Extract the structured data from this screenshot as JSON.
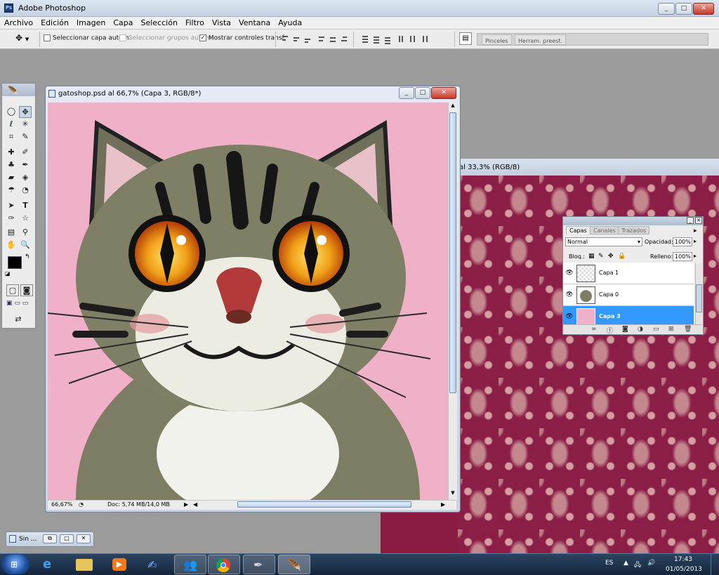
{
  "app": {
    "title": "Adobe Photoshop",
    "ps_logo": "Ps"
  },
  "window_buttons": {
    "minimize": "_",
    "maximize": "□",
    "close": "✕"
  },
  "menu": [
    "Archivo",
    "Edición",
    "Imagen",
    "Capa",
    "Selección",
    "Filtro",
    "Vista",
    "Ventana",
    "Ayuda"
  ],
  "options": {
    "auto_select_layer": "Seleccionar capa autom.",
    "auto_select_groups": "Seleccionar grupos autom.",
    "show_transform": "Mostrar controles transf."
  },
  "dock_tabs": [
    "Pinceles",
    "Herram. preest."
  ],
  "document": {
    "title": "gatoshop.psd al 66,7% (Capa 3, RGB/8*)",
    "zoom": "66,67%",
    "doc_size": "Doc: 5,74 MB/14,0 MB"
  },
  "background_document": {
    "title": "al 33,3% (RGB/8)"
  },
  "layers_panel": {
    "tabs": [
      "Capas",
      "Canales",
      "Trazados"
    ],
    "blend_mode": "Normal",
    "opacity_label": "Opacidad:",
    "opacity_value": "100%",
    "lock_label": "Bloq.:",
    "fill_label": "Relleno:",
    "fill_value": "100%",
    "layers": [
      {
        "name": "Capa 1",
        "selected": false
      },
      {
        "name": "Capa 0",
        "selected": false
      },
      {
        "name": "Capa 3",
        "selected": true
      }
    ]
  },
  "minimized_doc": {
    "title": "Sin ..."
  },
  "taskbar": {
    "language": "ES",
    "time": "17:43",
    "date": "01/05/2013",
    "apps": [
      "explorer",
      "internet-explorer",
      "file-explorer",
      "media-player",
      "paint-app",
      "messenger",
      "chrome",
      "brush-app",
      "photoshop"
    ]
  },
  "colors": {
    "canvas_bg": "#f0b0c8",
    "selected_layer": "#3399ff",
    "damask_bg": "#8a1c44"
  }
}
